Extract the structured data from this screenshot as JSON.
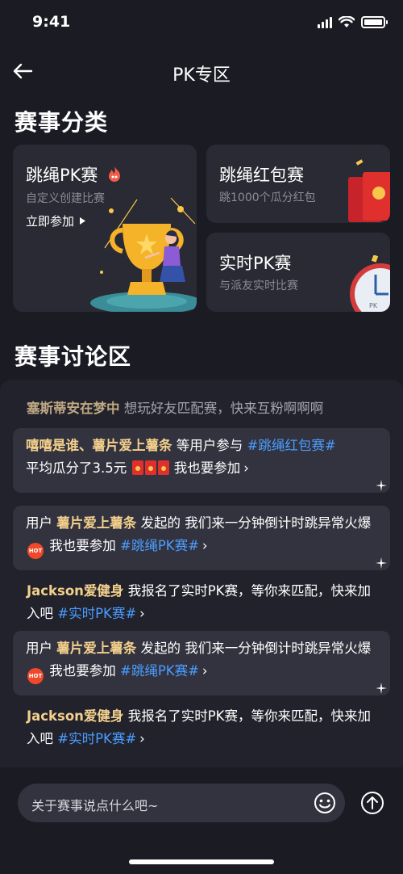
{
  "status": {
    "time": "9:41"
  },
  "nav": {
    "title": "PK专区"
  },
  "categories": {
    "heading": "赛事分类",
    "pk": {
      "title": "跳绳PK赛",
      "subtitle": "自定义创建比赛",
      "link": "立即参加"
    },
    "redpacket": {
      "title": "跳绳红包赛",
      "subtitle": "跳1000个瓜分红包"
    },
    "realtime": {
      "title": "实时PK赛",
      "subtitle": "与派友实时比赛",
      "clock_label": "PK"
    }
  },
  "discussion": {
    "heading": "赛事讨论区",
    "messages": [
      {
        "user": "塞斯蒂安在梦中",
        "text": "想玩好友匹配赛，快来互粉啊啊啊"
      },
      {
        "users": "嘻嘻是谁、薯片爱上薯条",
        "text1": "等用户参与",
        "tag": "#跳绳红包赛#",
        "text2": "平均瓜分了3.5元",
        "action": "我也要参加"
      },
      {
        "prefix": "用户",
        "user": "薯片爱上薯条",
        "text1": "发起的 我们来一分钟倒计时跳异常火爆",
        "hot": "HOT",
        "action": "我也要参加",
        "tag": "#跳绳PK赛#"
      },
      {
        "user": "Jackson爱健身",
        "text1": "我报名了实时PK赛，等你来匹配，快来加入吧",
        "tag": "#实时PK赛#"
      },
      {
        "prefix": "用户",
        "user": "薯片爱上薯条",
        "text1": "发起的 我们来一分钟倒计时跳异常火爆",
        "hot": "HOT",
        "action": "我也要参加",
        "tag": "#跳绳PK赛#"
      },
      {
        "user": "Jackson爱健身",
        "text1": "我报名了实时PK赛，等你来匹配，快来加入吧",
        "tag": "#实时PK赛#"
      }
    ]
  },
  "input": {
    "placeholder": "关于赛事说点什么吧~"
  },
  "colors": {
    "background": "#1b1b24",
    "card": "#2a2a34",
    "name": "#f3d08c",
    "tag": "#4a9dff",
    "hot": "#f2482a"
  },
  "icons": [
    "back-arrow-icon",
    "fire-icon",
    "play-triangle-icon",
    "trophy-illustration",
    "red-envelope-illustration",
    "clock-illustration",
    "red-envelope-icon",
    "hot-badge-icon",
    "chevron-right-icon",
    "sparkle-icon",
    "emoji-icon",
    "send-arrow-icon"
  ]
}
